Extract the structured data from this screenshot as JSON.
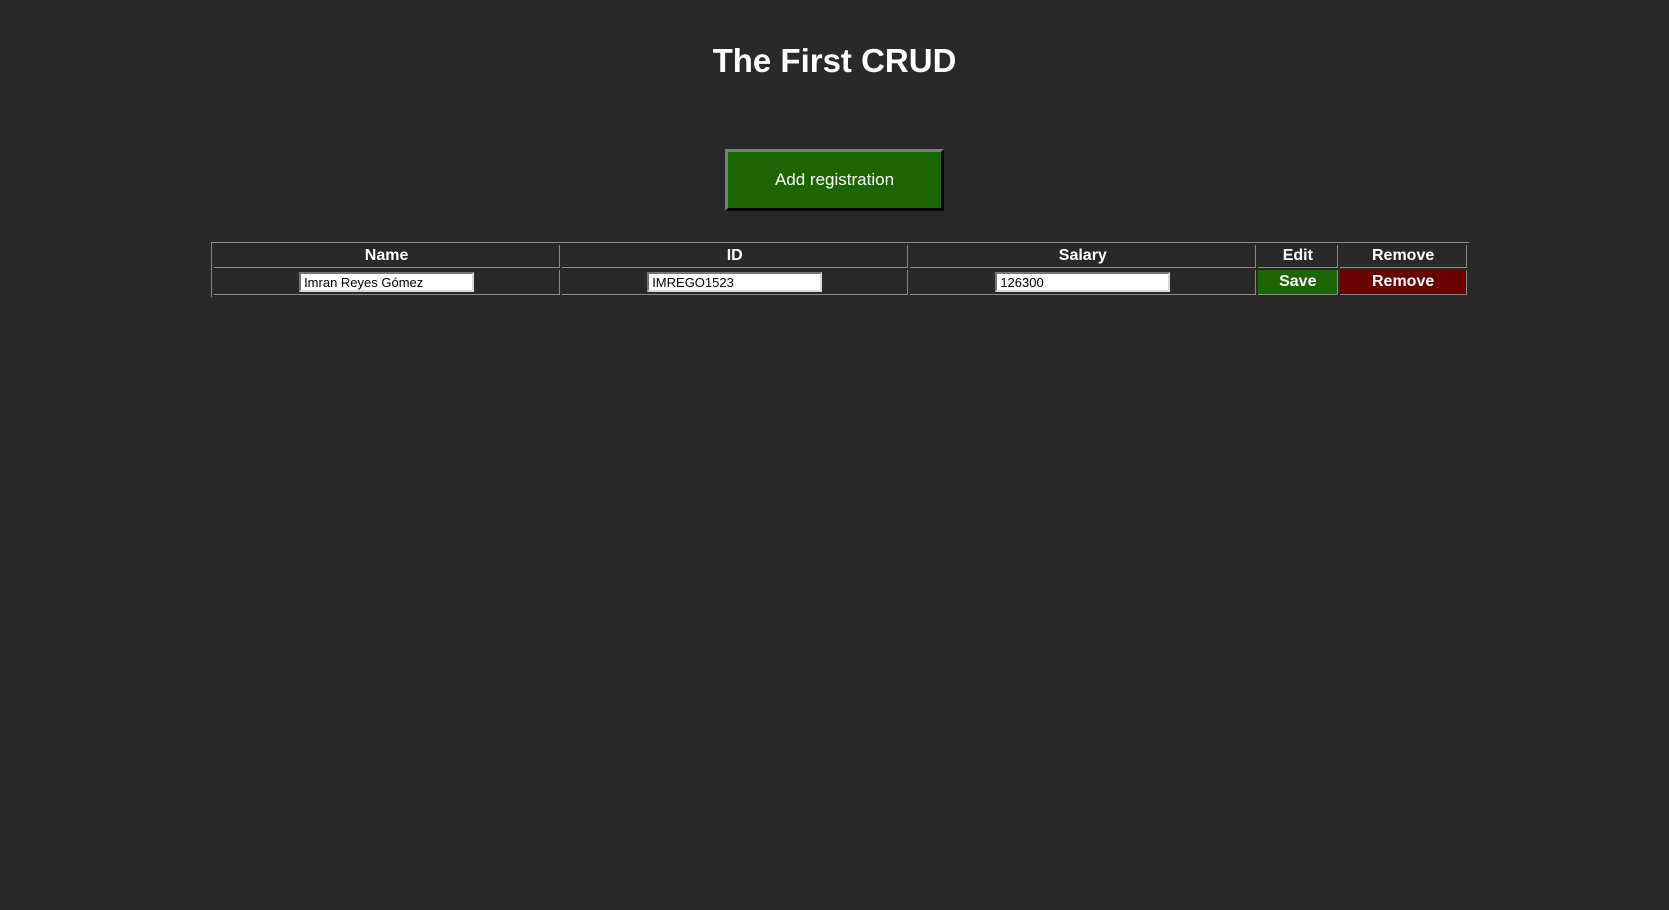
{
  "page": {
    "title": "The First CRUD",
    "add_button_label": "Add registration"
  },
  "table": {
    "headers": {
      "name": "Name",
      "id": "ID",
      "salary": "Salary",
      "edit": "Edit",
      "remove": "Remove"
    },
    "rows": [
      {
        "name": "Imran Reyes Gómez",
        "id": "IMREGO1523",
        "salary": "126300",
        "save_label": "Save",
        "remove_label": "Remove"
      }
    ]
  },
  "colors": {
    "background": "#292929",
    "save_green": "#1b6600",
    "remove_red": "#6b0000",
    "text": "#ffffff"
  }
}
